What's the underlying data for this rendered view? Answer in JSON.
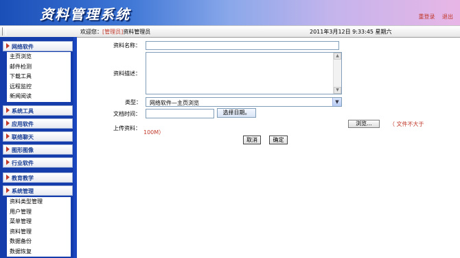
{
  "header": {
    "logo_text": "资料管理系统",
    "links": [
      "重登录",
      "退出"
    ]
  },
  "statusbar": {
    "welcome_prefix": "欢迎您：",
    "role": "[管理员]",
    "username": "资料管理员",
    "datetime": "2011年3月12日  9:33:45  星期六"
  },
  "sidebar": {
    "categories": [
      {
        "label": "网络软件",
        "items": [
          "主页浏览",
          "邮件检测",
          "下载工具",
          "远程监控",
          "新闻阅读"
        ]
      },
      {
        "label": "系统工具"
      },
      {
        "label": "应用软件"
      },
      {
        "label": "联络聊天"
      },
      {
        "label": "图形图像"
      },
      {
        "label": "行业软件"
      },
      {
        "label": "教育教学"
      },
      {
        "label": "系统管理",
        "items": [
          "资料类型管理",
          "用户管理",
          "菜单管理",
          "资料管理",
          "数据备份",
          "数据恢复"
        ]
      }
    ]
  },
  "form": {
    "name_label": "资料名称：",
    "name_value": "",
    "desc_label": "资料描述：",
    "desc_value": "",
    "type_label": "类型：",
    "type_value": "网络软件—主页浏览",
    "time_label": "文档时间：",
    "time_value": "",
    "date_button": "选择日期。",
    "upload_label": "上传资料：",
    "browse_button": "浏览...",
    "note_part1": "（ 文件不大于",
    "note_part2": "100M）",
    "cancel_button": "取消",
    "confirm_button": "确定"
  },
  "colors": {
    "sidebar_bg": "#143dab",
    "accent_red": "#c0392b",
    "category_text": "#1a3f94"
  }
}
